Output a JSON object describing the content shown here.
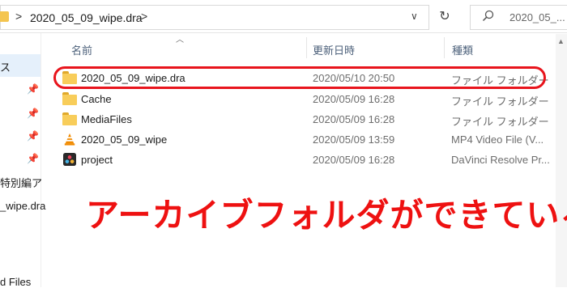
{
  "address_bar": {
    "crumb": "2020_05_09_wipe.dra",
    "separator": ">",
    "dropdown": "∨",
    "refresh": "↻"
  },
  "search": {
    "icon": "search-icon",
    "placeholder": "2020_05_..."
  },
  "nav": {
    "items": [
      {
        "label": "ス"
      },
      {
        "label": "特別編ア"
      },
      {
        "label": "_wipe.dra"
      },
      {
        "label": "d Files"
      }
    ]
  },
  "columns": {
    "name": "名前",
    "date": "更新日時",
    "type": "種類"
  },
  "files": [
    {
      "name": "2020_05_09_wipe.dra",
      "date": "2020/05/10 20:50",
      "type": "ファイル フォルダー",
      "icon": "folder-icon"
    },
    {
      "name": "Cache",
      "date": "2020/05/09 16:28",
      "type": "ファイル フォルダー",
      "icon": "folder-icon"
    },
    {
      "name": "MediaFiles",
      "date": "2020/05/09 16:28",
      "type": "ファイル フォルダー",
      "icon": "folder-icon"
    },
    {
      "name": "2020_05_09_wipe",
      "date": "2020/05/09 13:59",
      "type": "MP4 Video File (V...",
      "icon": "vlc-cone-icon"
    },
    {
      "name": "project",
      "date": "2020/05/09 16:28",
      "type": "DaVinci Resolve Pr...",
      "icon": "davinci-resolve-icon"
    }
  ],
  "annotation": {
    "text": "アーカイブフォルダができている",
    "color": "#ee1111"
  },
  "colors": {
    "highlight": "#e8141c",
    "folder": "#f8cd5a",
    "nav_selected": "#e5f0fb"
  }
}
